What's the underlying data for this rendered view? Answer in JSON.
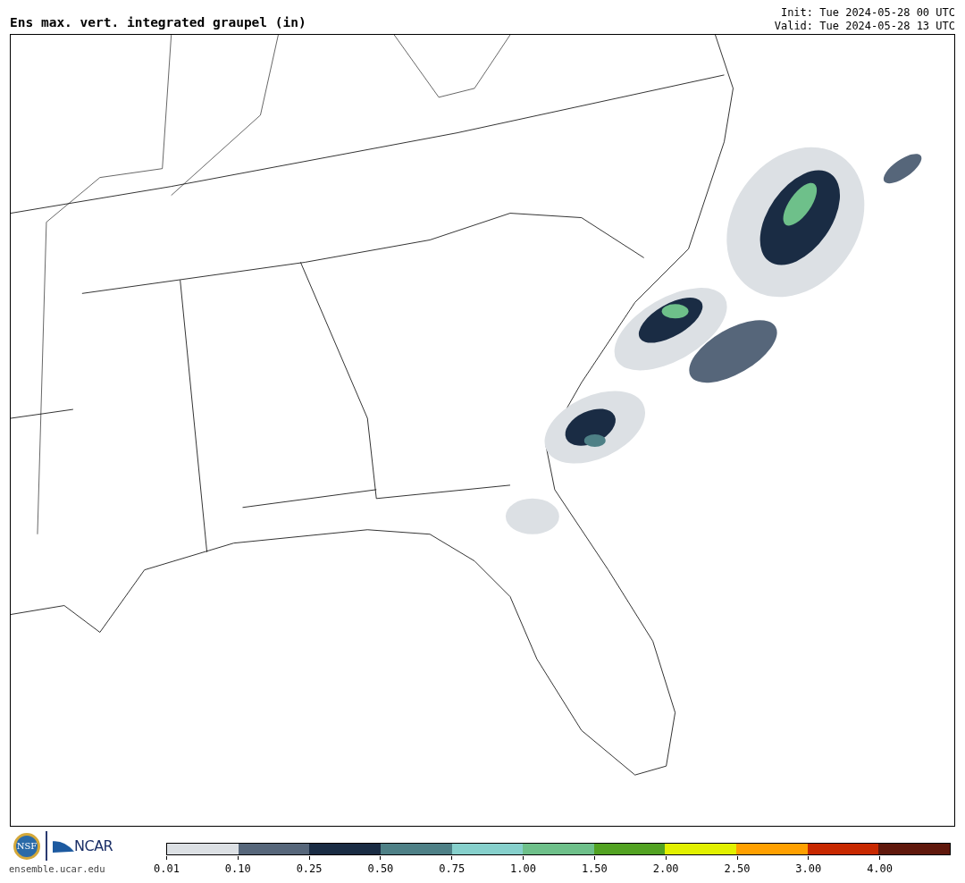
{
  "title": "Ens max. vert. integrated graupel (in)",
  "init": "Init: Tue 2024-05-28 00 UTC",
  "valid": "Valid: Tue 2024-05-28 13 UTC",
  "logos": {
    "nsf": "NSF",
    "ncar": "NCAR",
    "site": "ensemble.ucar.edu"
  },
  "colorbar": [
    {
      "label": "0.01",
      "color": "#dce0e4"
    },
    {
      "label": "0.10",
      "color": "#56667a"
    },
    {
      "label": "0.25",
      "color": "#1a2c44"
    },
    {
      "label": "0.50",
      "color": "#4e8086"
    },
    {
      "label": "0.75",
      "color": "#86d0cc"
    },
    {
      "label": "1.00",
      "color": "#6ec08a"
    },
    {
      "label": "1.50",
      "color": "#52a222"
    },
    {
      "label": "2.00",
      "color": "#e2f000"
    },
    {
      "label": "2.50",
      "color": "#ffa000"
    },
    {
      "label": "3.00",
      "color": "#c82800"
    },
    {
      "label": "4.00",
      "color": "#60180c"
    }
  ]
}
